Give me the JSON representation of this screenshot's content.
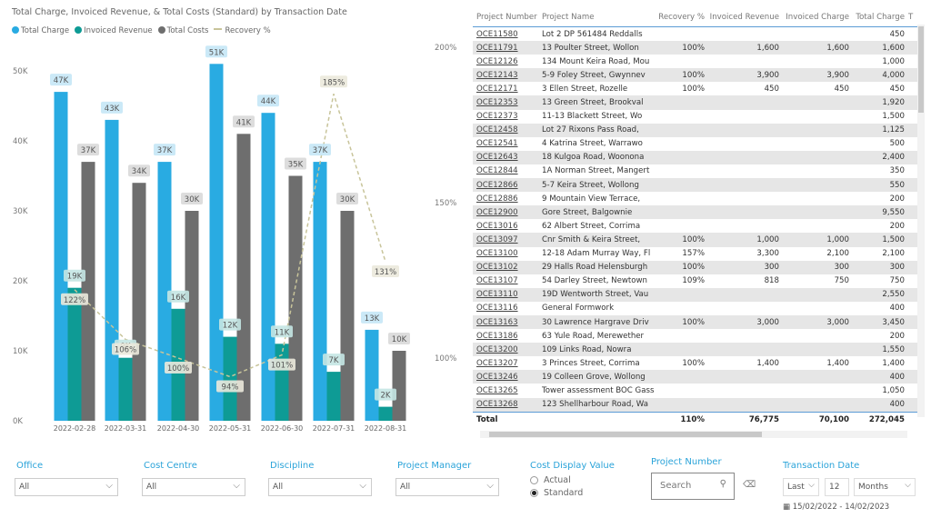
{
  "chart": {
    "title": "Total Charge, Invoiced Revenue, & Total Costs (Standard) by Transaction Date",
    "colors": {
      "total_charge": "#29abe2",
      "invoiced_revenue": "#0e9b95",
      "total_costs": "#6e6e6e",
      "recovery": "#c8c49a"
    }
  },
  "chart_data": {
    "type": "bar",
    "title": "Total Charge, Invoiced Revenue, & Total Costs (Standard) by Transaction Date",
    "categories": [
      "2022-02-28",
      "2022-03-31",
      "2022-04-30",
      "2022-05-31",
      "2022-06-30",
      "2022-07-31",
      "2022-08-31"
    ],
    "series": [
      {
        "name": "Total Charge",
        "values": [
          47,
          43,
          37,
          51,
          44,
          37,
          13
        ],
        "labels": [
          "47K",
          "43K",
          "37K",
          "51K",
          "44K",
          "37K",
          "13K"
        ]
      },
      {
        "name": "Invoiced Revenue",
        "values": [
          19,
          9,
          16,
          12,
          11,
          7,
          2
        ],
        "labels": [
          "19K",
          "9K",
          "16K",
          "12K",
          "11K",
          "7K",
          "2K"
        ]
      },
      {
        "name": "Total Costs",
        "values": [
          37,
          34,
          30,
          41,
          35,
          30,
          10
        ],
        "labels": [
          "37K",
          "34K",
          "30K",
          "41K",
          "35K",
          "30K",
          "10K"
        ]
      },
      {
        "name": "Recovery %",
        "type": "line",
        "axis": "right",
        "values": [
          122,
          106,
          100,
          94,
          101,
          185,
          131
        ],
        "labels": [
          "122%",
          "106%",
          "100%",
          "94%",
          "101%",
          "185%",
          "131%"
        ]
      }
    ],
    "yticks": [
      "0K",
      "10K",
      "20K",
      "30K",
      "40K",
      "50K"
    ],
    "ylim": [
      0,
      50
    ],
    "y2ticks": [
      "100%",
      "150%",
      "200%"
    ],
    "legend": "top-left"
  },
  "table": {
    "headers": [
      "Project Number",
      "Project Name",
      "Recovery %",
      "Invoiced Revenue",
      "Invoiced Charge",
      "Total Charge",
      "T"
    ],
    "rows": [
      [
        "OCE11580",
        "Lot 2 DP 561484 Reddalls",
        "",
        "",
        "",
        "450"
      ],
      [
        "OCE11791",
        "13 Poulter Street, Wollon",
        "100%",
        "1,600",
        "1,600",
        "1,600"
      ],
      [
        "OCE12126",
        "134 Mount Keira Road, Mou",
        "",
        "",
        "",
        "1,000"
      ],
      [
        "OCE12143",
        "5-9 Foley Street, Gwynnev",
        "100%",
        "3,900",
        "3,900",
        "4,000"
      ],
      [
        "OCE12171",
        "3 Ellen Street, Rozelle",
        "100%",
        "450",
        "450",
        "450"
      ],
      [
        "OCE12353",
        "13 Green Street, Brookval",
        "",
        "",
        "",
        "1,920"
      ],
      [
        "OCE12373",
        "11-13 Blackett Street, Wo",
        "",
        "",
        "",
        "1,500"
      ],
      [
        "OCE12458",
        "Lot 27 Rixons Pass Road,",
        "",
        "",
        "",
        "1,125"
      ],
      [
        "OCE12541",
        "4 Katrina Street, Warrawo",
        "",
        "",
        "",
        "500"
      ],
      [
        "OCE12643",
        "18 Kulgoa Road, Woonona",
        "",
        "",
        "",
        "2,400"
      ],
      [
        "OCE12844",
        "1A Norman Street, Mangert",
        "",
        "",
        "",
        "350"
      ],
      [
        "OCE12866",
        "5-7 Keira Street, Wollong",
        "",
        "",
        "",
        "550"
      ],
      [
        "OCE12886",
        "9 Mountain View Terrace,",
        "",
        "",
        "",
        "200"
      ],
      [
        "OCE12900",
        "Gore Street, Balgownie",
        "",
        "",
        "",
        "9,550"
      ],
      [
        "OCE13016",
        "62 Albert Street, Corrima",
        "",
        "",
        "",
        "200"
      ],
      [
        "OCE13097",
        "Cnr Smith & Keira Street,",
        "100%",
        "1,000",
        "1,000",
        "1,500"
      ],
      [
        "OCE13100",
        "12-18 Adam Murray Way, Fl",
        "157%",
        "3,300",
        "2,100",
        "2,100"
      ],
      [
        "OCE13102",
        "29 Halls Road Helensburgh",
        "100%",
        "300",
        "300",
        "300"
      ],
      [
        "OCE13107",
        "54 Darley Street, Newtown",
        "109%",
        "818",
        "750",
        "750"
      ],
      [
        "OCE13110",
        "19D Wentworth Street, Vau",
        "",
        "",
        "",
        "2,550"
      ],
      [
        "OCE13116",
        "General Formwork",
        "",
        "",
        "",
        "400"
      ],
      [
        "OCE13163",
        "30 Lawrence Hargrave Driv",
        "100%",
        "3,000",
        "3,000",
        "3,450"
      ],
      [
        "OCE13186",
        "63 Yule Road, Merewether",
        "",
        "",
        "",
        "200"
      ],
      [
        "OCE13200",
        "109 Links Road, Nowra",
        "",
        "",
        "",
        "1,550"
      ],
      [
        "OCE13207",
        "3 Princes Street, Corrima",
        "100%",
        "1,400",
        "1,400",
        "1,400"
      ],
      [
        "OCE13246",
        "19 Colleen Grove, Wollong",
        "",
        "",
        "",
        "400"
      ],
      [
        "OCE13265",
        "Tower assessment BOC Gass",
        "",
        "",
        "",
        "1,050"
      ],
      [
        "OCE13268",
        "123 Shellharbour Road, Wa",
        "",
        "",
        "",
        "400"
      ]
    ],
    "total": [
      "Total",
      "",
      "110%",
      "76,775",
      "70,100",
      "272,045"
    ]
  },
  "filters": {
    "office": {
      "label": "Office",
      "value": "All"
    },
    "cost_centre": {
      "label": "Cost Centre",
      "value": "All"
    },
    "discipline": {
      "label": "Discipline",
      "value": "All"
    },
    "project_manager": {
      "label": "Project Manager",
      "value": "All"
    },
    "cost_display": {
      "label": "Cost Display Value",
      "options": [
        "Actual",
        "Standard"
      ],
      "selected": "Standard"
    },
    "project_number": {
      "label": "Project Number",
      "placeholder": "Search"
    },
    "transaction_date": {
      "label": "Transaction Date",
      "mode": "Last",
      "count": "12",
      "unit": "Months",
      "range": "15/02/2022 - 14/02/2023"
    }
  }
}
